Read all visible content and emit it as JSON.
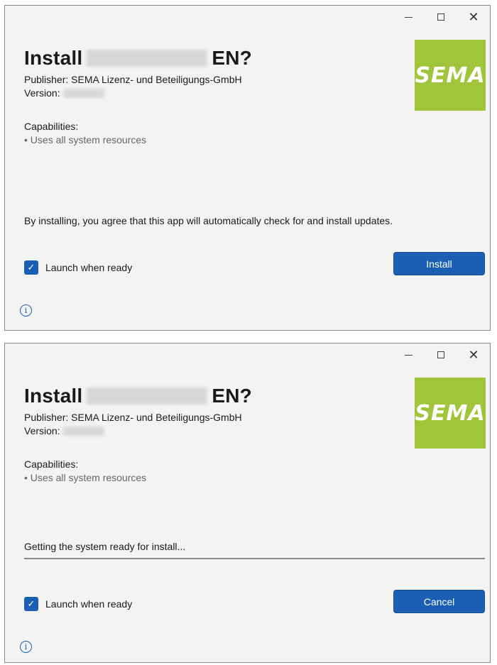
{
  "window1": {
    "title_prefix": "Install",
    "title_suffix": "EN?",
    "publisher": "Publisher: SEMA Lizenz- und Beteiligungs-GmbH",
    "version_label": "Version:",
    "capabilities_title": "Capabilities:",
    "capabilities_item": "• Uses all system resources",
    "logo_text": "SEMA",
    "agreement": "By installing, you agree that this app will automatically check for and install updates.",
    "launch_label": "Launch when ready",
    "launch_checked": true,
    "primary_button": "Install",
    "info_glyph": "i"
  },
  "window2": {
    "title_prefix": "Install",
    "title_suffix": "EN?",
    "publisher": "Publisher: SEMA Lizenz- und Beteiligungs-GmbH",
    "version_label": "Version:",
    "capabilities_title": "Capabilities:",
    "capabilities_item": "• Uses all system resources",
    "logo_text": "SEMA",
    "progress_label": "Getting the system ready for install...",
    "progress_fraction": 0,
    "launch_label": "Launch when ready",
    "launch_checked": true,
    "primary_button": "Cancel",
    "info_glyph": "i"
  },
  "colors": {
    "accent": "#1a5fb4",
    "logo_bg": "#a0c53a",
    "window_bg": "#f3f3f3"
  },
  "icons": {
    "minimize": "minimize-icon",
    "maximize": "maximize-icon",
    "close": "close-icon",
    "check": "checkmark-icon",
    "info": "info-icon"
  }
}
